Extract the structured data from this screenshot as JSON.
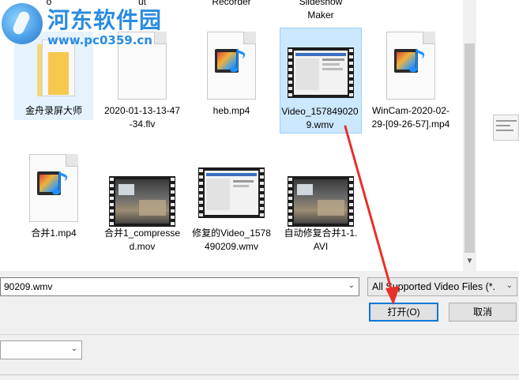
{
  "watermark": {
    "title": "河东软件园",
    "url": "www.pc0359.cn"
  },
  "top_row_partial": [
    {
      "label": "o"
    },
    {
      "label": "ut"
    },
    {
      "label": "Recorder"
    },
    {
      "label": "Slideshow\nMaker"
    }
  ],
  "files": [
    {
      "name": "金舟录屏大师",
      "kind": "folder"
    },
    {
      "name": "2020-01-13-13-47-34.flv",
      "kind": "doc"
    },
    {
      "name": "heb.mp4",
      "kind": "media"
    },
    {
      "name": "Video_1578490209.wmv",
      "kind": "video",
      "selected": true
    },
    {
      "name": "WinCam-2020-02-29-[09-26-57].mp4",
      "kind": "media"
    },
    {
      "name": "合并1.mp4",
      "kind": "media"
    },
    {
      "name": "合并1_compressed.mov",
      "kind": "video"
    },
    {
      "name": "修复的Video_1578490209.wmv",
      "kind": "video"
    },
    {
      "name": "自动修复合并1-1.AVI",
      "kind": "video"
    }
  ],
  "filename_field": {
    "value": "90209.wmv"
  },
  "filter": {
    "selected": "All Supported Video Files (*."
  },
  "buttons": {
    "open": "打开(O)",
    "cancel": "取消"
  },
  "colors": {
    "accent": "#0078d7",
    "selection": "#cce8ff",
    "arrow": "#e8302a"
  },
  "icons": [
    "folder-icon",
    "document-icon",
    "media-file-icon",
    "video-thumbnail",
    "chevron-down-icon"
  ]
}
